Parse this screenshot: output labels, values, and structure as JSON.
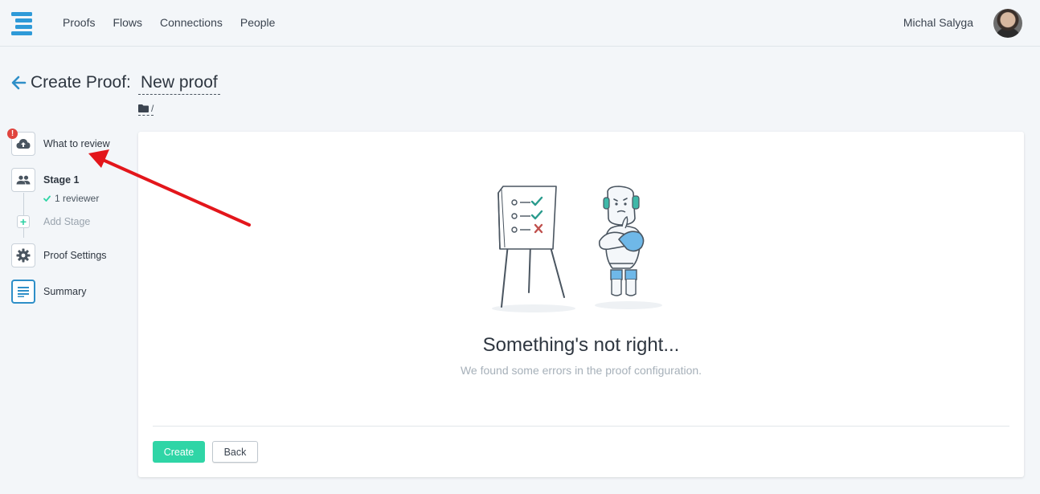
{
  "nav": {
    "items": [
      {
        "label": "Proofs"
      },
      {
        "label": "Flows"
      },
      {
        "label": "Connections"
      },
      {
        "label": "People"
      }
    ],
    "user_name": "Michal Salyga"
  },
  "header": {
    "title": "Create Proof:",
    "proof_name": "New proof",
    "folder_path": "/"
  },
  "sidebar": {
    "what_to_review": "What to review",
    "error_mark": "!",
    "stage_label": "Stage 1",
    "reviewer_text": "1 reviewer",
    "add_stage": "Add Stage",
    "proof_settings": "Proof Settings",
    "summary": "Summary"
  },
  "main": {
    "error_title": "Something's not right...",
    "error_subtitle": "We found some errors in the proof configuration.",
    "create_label": "Create",
    "back_label": "Back"
  },
  "colors": {
    "accent": "#2e8fc8",
    "primary_button": "#2fd5a6",
    "error": "#e0443e",
    "annotation_arrow": "#e3161b"
  }
}
